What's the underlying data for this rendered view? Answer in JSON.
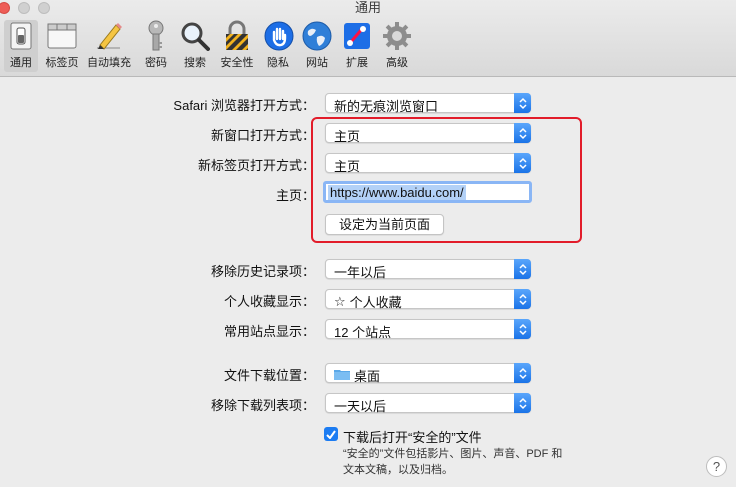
{
  "window": {
    "title": "通用"
  },
  "toolbar": {
    "items": [
      {
        "label": "通用",
        "icon": "switch-icon",
        "selected": true
      },
      {
        "label": "标签页",
        "icon": "tabs-icon"
      },
      {
        "label": "自动填充",
        "icon": "pencil-icon"
      },
      {
        "label": "密码",
        "icon": "key-icon"
      },
      {
        "label": "搜索",
        "icon": "magnifier-icon"
      },
      {
        "label": "安全性",
        "icon": "lock-icon"
      },
      {
        "label": "隐私",
        "icon": "hand-icon"
      },
      {
        "label": "网站",
        "icon": "globe-icon"
      },
      {
        "label": "扩展",
        "icon": "puzzle-icon"
      },
      {
        "label": "高级",
        "icon": "gear-icon"
      }
    ]
  },
  "form": {
    "safari_open_label": "Safari 浏览器打开方式：",
    "safari_open_value": "新的无痕浏览窗口",
    "new_window_label": "新窗口打开方式：",
    "new_window_value": "主页",
    "new_tab_label": "新标签页打开方式：",
    "new_tab_value": "主页",
    "homepage_label": "主页：",
    "homepage_value": "https://www.baidu.com/",
    "set_current_button": "设定为当前页面",
    "remove_history_label": "移除历史记录项：",
    "remove_history_value": "一年以后",
    "favorites_label": "个人收藏显示：",
    "favorites_value": "个人收藏",
    "top_sites_label": "常用站点显示：",
    "top_sites_value": "12 个站点",
    "download_location_label": "文件下载位置：",
    "download_location_value": "桌面",
    "remove_downloads_label": "移除下载列表项：",
    "remove_downloads_value": "一天以后",
    "open_safe_label": "下载后打开“安全的”文件",
    "open_safe_checked": true,
    "safe_note_line1": "“安全的”文件包括影片、图片、声音、PDF 和",
    "safe_note_line2": "文本文稿，以及归档。"
  },
  "help_label": "?",
  "colors": {
    "accent": "#1c7cf2",
    "highlight_box": "#e21c2a"
  }
}
